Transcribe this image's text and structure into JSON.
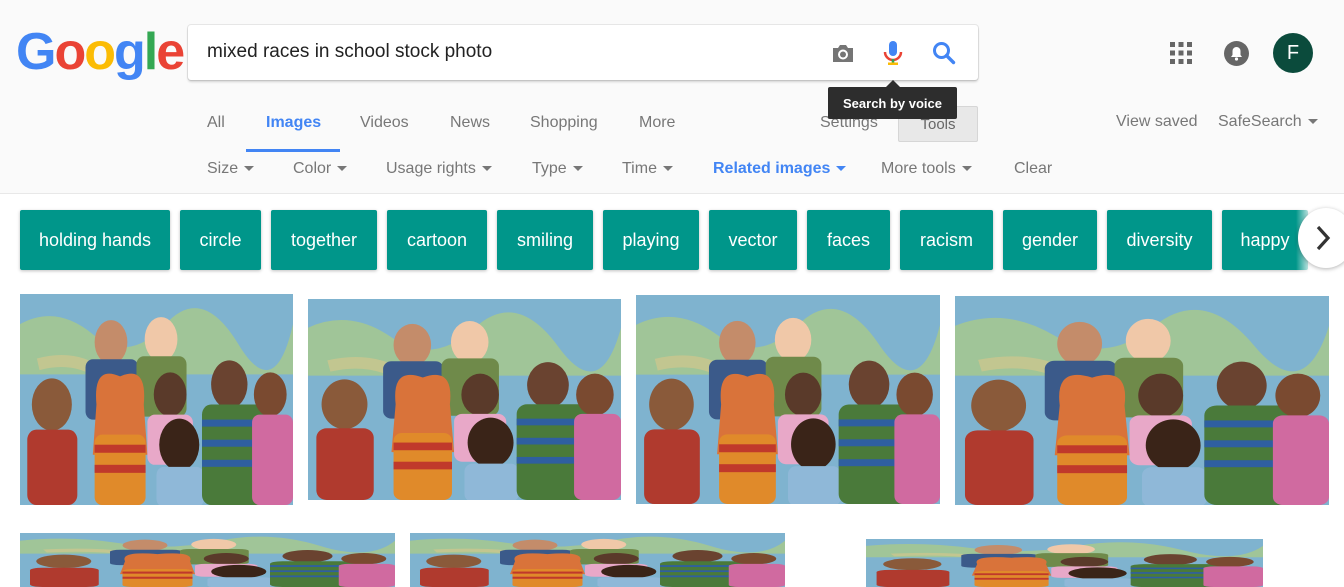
{
  "logo": {
    "letters": [
      "G",
      "o",
      "o",
      "g",
      "l",
      "e"
    ],
    "colors": [
      "#4285f4",
      "#ea4335",
      "#fbbc05",
      "#4285f4",
      "#34a853",
      "#ea4335"
    ]
  },
  "search": {
    "query": "mixed races in school stock photo",
    "tooltip": "Search by voice"
  },
  "icons": [
    "camera-icon",
    "microphone-icon",
    "search-icon",
    "apps-icon",
    "notifications-icon"
  ],
  "account": {
    "initial": "F",
    "color": "#0b4b3c"
  },
  "tabs": {
    "all": "All",
    "images": "Images",
    "videos": "Videos",
    "news": "News",
    "shopping": "Shopping",
    "more": "More",
    "settings": "Settings",
    "tools": "Tools"
  },
  "right_links": {
    "view_saved": "View saved",
    "safesearch": "SafeSearch"
  },
  "filters": {
    "size": "Size",
    "color": "Color",
    "usage_rights": "Usage rights",
    "type": "Type",
    "time": "Time",
    "related_images": "Related images",
    "more_tools": "More tools",
    "clear": "Clear"
  },
  "chips": [
    "holding hands",
    "circle",
    "together",
    "cartoon",
    "smiling",
    "playing",
    "vector",
    "faces",
    "racism",
    "gender",
    "diversity",
    "happy"
  ],
  "colors": {
    "chip": "#00968a",
    "accent": "#4285f4"
  }
}
